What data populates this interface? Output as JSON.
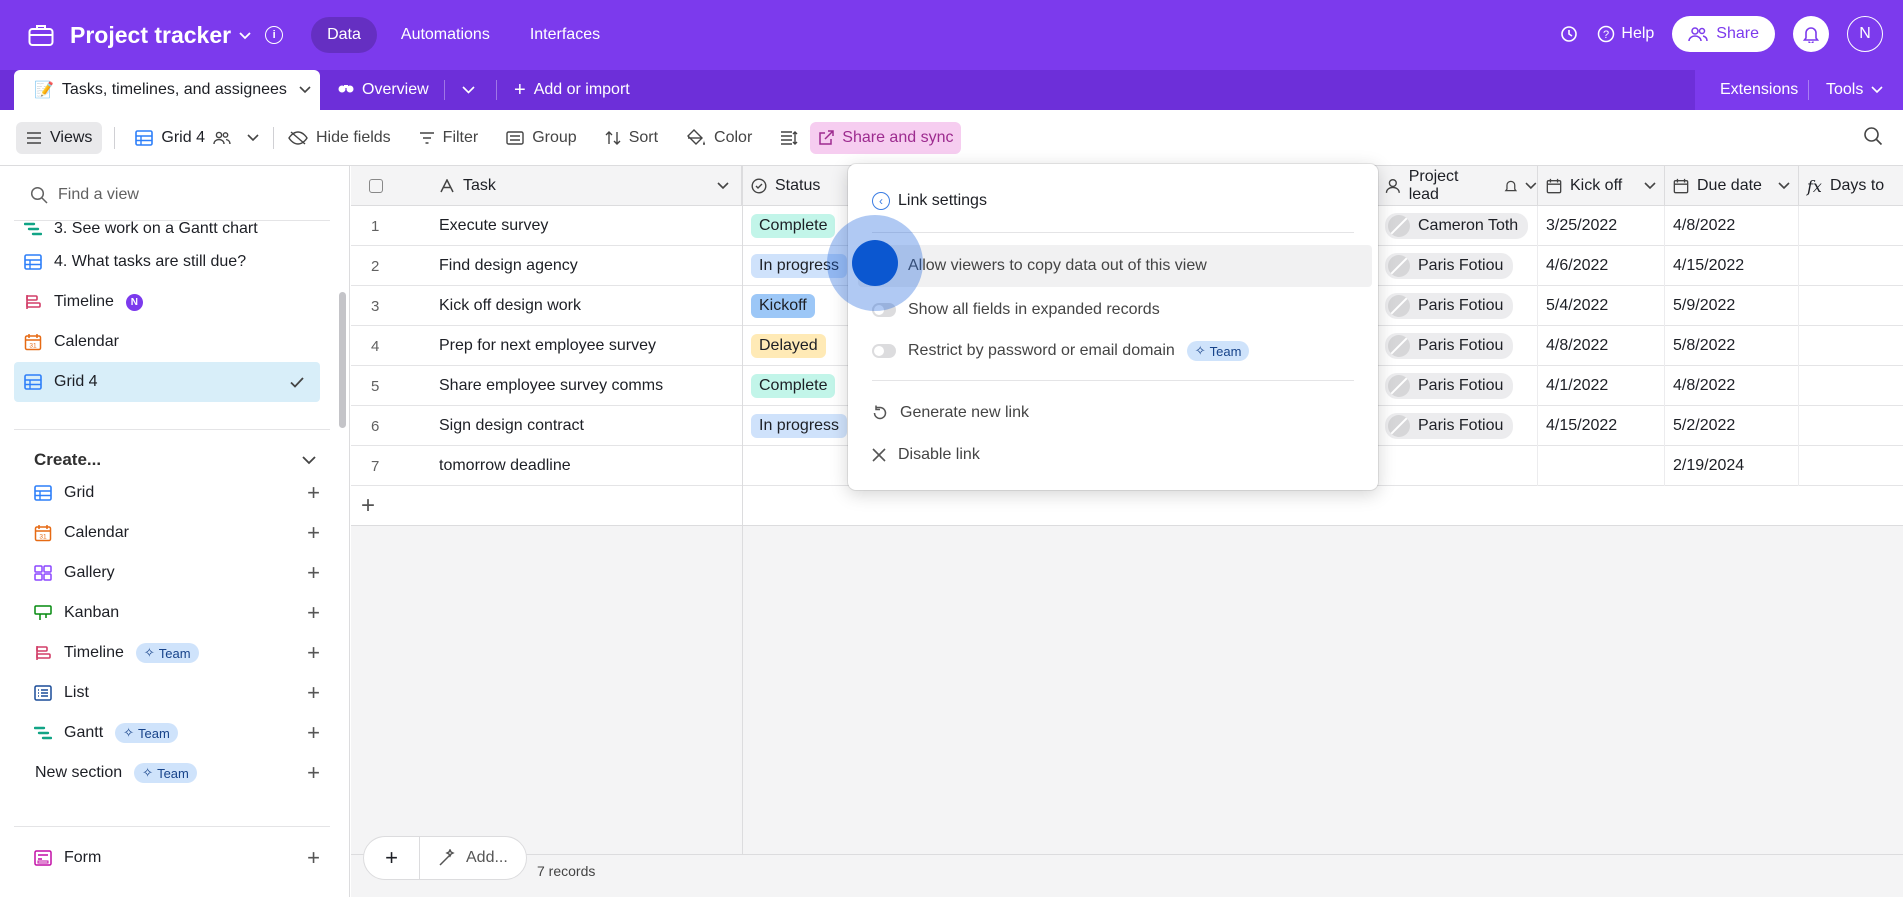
{
  "app": {
    "title": "Project tracker",
    "nav": [
      "Data",
      "Automations",
      "Interfaces"
    ],
    "active_nav": "Data",
    "help_label": "Help",
    "share_label": "Share",
    "avatar_initial": "N",
    "accent_color": "#7c3aed"
  },
  "tabs": {
    "active_tab": "Tasks, timelines, and assignees",
    "overview": "Overview",
    "add_or_import": "Add or import",
    "extensions": "Extensions",
    "tools": "Tools"
  },
  "toolbar": {
    "views": "Views",
    "current_view": "Grid 4",
    "hide_fields": "Hide fields",
    "filter": "Filter",
    "group": "Group",
    "sort": "Sort",
    "color": "Color",
    "share_and_sync": "Share and sync"
  },
  "sidebar": {
    "find_placeholder": "Find a view",
    "views": [
      {
        "label": "3. See work on a Gantt chart",
        "icon": "gantt-icon"
      },
      {
        "label": "4. What tasks are still due?",
        "icon": "grid-icon"
      },
      {
        "label": "Timeline",
        "icon": "timeline-icon",
        "badge": "N"
      },
      {
        "label": "Calendar",
        "icon": "calendar-icon"
      },
      {
        "label": "Grid 4",
        "icon": "grid-icon",
        "active": true
      }
    ],
    "create_label": "Create...",
    "create_items": [
      {
        "label": "Grid",
        "icon": "grid-icon"
      },
      {
        "label": "Calendar",
        "icon": "calendar-icon"
      },
      {
        "label": "Gallery",
        "icon": "gallery-icon"
      },
      {
        "label": "Kanban",
        "icon": "kanban-icon"
      },
      {
        "label": "Timeline",
        "icon": "timeline-icon",
        "badge": "Team"
      },
      {
        "label": "List",
        "icon": "list-icon"
      },
      {
        "label": "Gantt",
        "icon": "gantt-icon",
        "badge": "Team"
      },
      {
        "label": "New section",
        "badge": "Team"
      }
    ],
    "form_label": "Form"
  },
  "grid": {
    "columns": {
      "task": "Task",
      "status": "Status",
      "project_lead": "Project lead",
      "kick_off": "Kick off",
      "due_date": "Due date",
      "days_to": "Days to"
    },
    "rows": [
      {
        "n": "1",
        "task": "Execute survey",
        "status": "Complete",
        "lead": "Cameron Toth",
        "kickoff": "3/25/2022",
        "due": "4/8/2022"
      },
      {
        "n": "2",
        "task": "Find design agency",
        "status": "In progress",
        "lead": "Paris Fotiou",
        "kickoff": "4/6/2022",
        "due": "4/15/2022"
      },
      {
        "n": "3",
        "task": "Kick off design work",
        "status": "Kickoff",
        "lead": "Paris Fotiou",
        "kickoff": "5/4/2022",
        "due": "5/9/2022"
      },
      {
        "n": "4",
        "task": "Prep for next employee survey",
        "status": "Delayed",
        "lead": "Paris Fotiou",
        "kickoff": "4/8/2022",
        "due": "5/8/2022"
      },
      {
        "n": "5",
        "task": "Share employee survey comms",
        "status": "Complete",
        "lead": "Paris Fotiou",
        "kickoff": "4/1/2022",
        "due": "4/8/2022"
      },
      {
        "n": "6",
        "task": "Sign design contract",
        "status": "In progress",
        "lead": "Paris Fotiou",
        "kickoff": "4/15/2022",
        "due": "5/2/2022"
      },
      {
        "n": "7",
        "task": "tomorrow deadline",
        "status": "",
        "lead": "",
        "kickoff": "",
        "due": "2/19/2024"
      }
    ],
    "status_colors": {
      "Complete": "#c2f5e9",
      "In progress": "#cfe2fb",
      "Kickoff": "#9cc7f7",
      "Delayed": "#ffeab6"
    },
    "add_label": "Add...",
    "records": "7 records"
  },
  "popup": {
    "back_label": "Link settings",
    "option_copy": "Allow viewers to copy data out of this view",
    "option_fields": "Show all fields in expanded records",
    "option_restrict": "Restrict by password or email domain",
    "restrict_badge": "Team",
    "generate": "Generate new link",
    "disable": "Disable link"
  }
}
